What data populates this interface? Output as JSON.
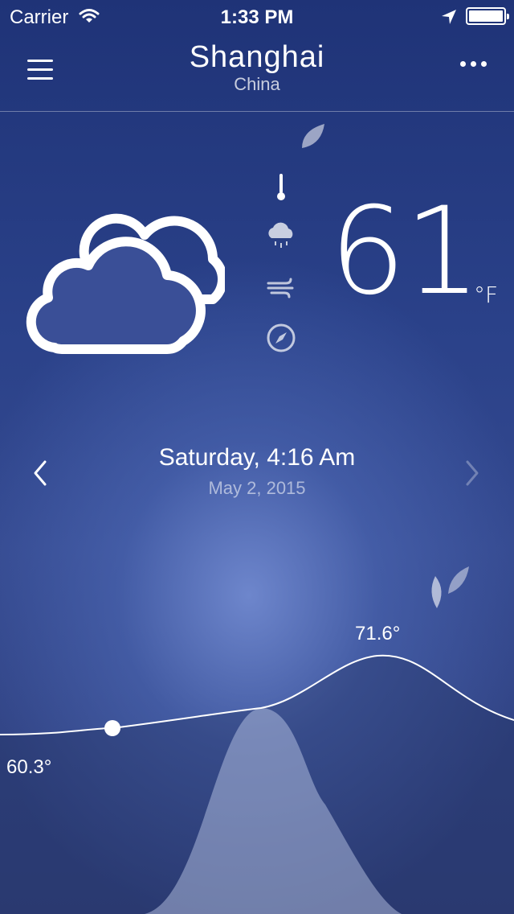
{
  "status_bar": {
    "carrier": "Carrier",
    "time": "1:33 PM",
    "wifi_icon": "wifi-icon",
    "location_icon": "location-arrow-icon",
    "battery_icon": "battery-full-icon"
  },
  "header": {
    "city": "Shanghai",
    "country": "China",
    "menu_icon": "hamburger-menu-icon",
    "more_icon": "more-dots-icon"
  },
  "current": {
    "condition_icon": "cloudy-icon",
    "temperature": "61",
    "unit": "°F",
    "detail_icons": [
      "thermometer-icon",
      "rain-icon",
      "wind-icon",
      "compass-icon"
    ]
  },
  "date_nav": {
    "day_time": "Saturday, 4:16 Am",
    "date": "May 2, 2015",
    "prev_icon": "chevron-left-icon",
    "next_icon": "chevron-right-icon"
  },
  "chart": {
    "high_label": "71.6°",
    "low_label": "60.3°"
  },
  "colors": {
    "background_top": "#1f3377",
    "background_glow": "#6f86c8",
    "text": "#ffffff"
  }
}
